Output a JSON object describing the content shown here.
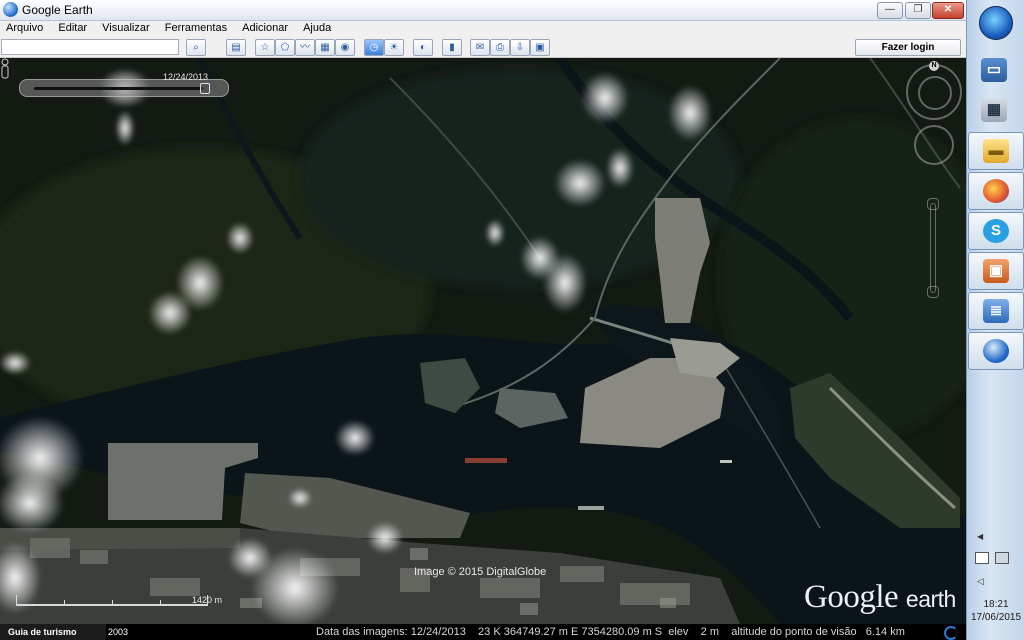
{
  "window": {
    "title": "Google Earth"
  },
  "menu": [
    "Arquivo",
    "Editar",
    "Visualizar",
    "Ferramentas",
    "Adicionar",
    "Ajuda"
  ],
  "toolbar": {
    "search_value": "",
    "login_label": "Fazer login"
  },
  "map": {
    "time_label": "12/24/2013",
    "copyright": "Image © 2015 DigitalGlobe",
    "watermark_main": "Google",
    "watermark_sub": "earth",
    "scale_label": "1420 m"
  },
  "statusbar": {
    "tour_label": "Guia de turismo",
    "year": "2003",
    "info": "Data das imagens: 12/24/2013    23 K 364749.27 m E 7354280.09 m S  elev    2 m    altitude do ponto de visão   6.14 km"
  },
  "taskbar": {
    "time": "18:21",
    "date": "17/06/2015"
  },
  "colors": {
    "accent": "#2b78d6",
    "map_dark": "#0f1510",
    "water": "#0b1419"
  }
}
